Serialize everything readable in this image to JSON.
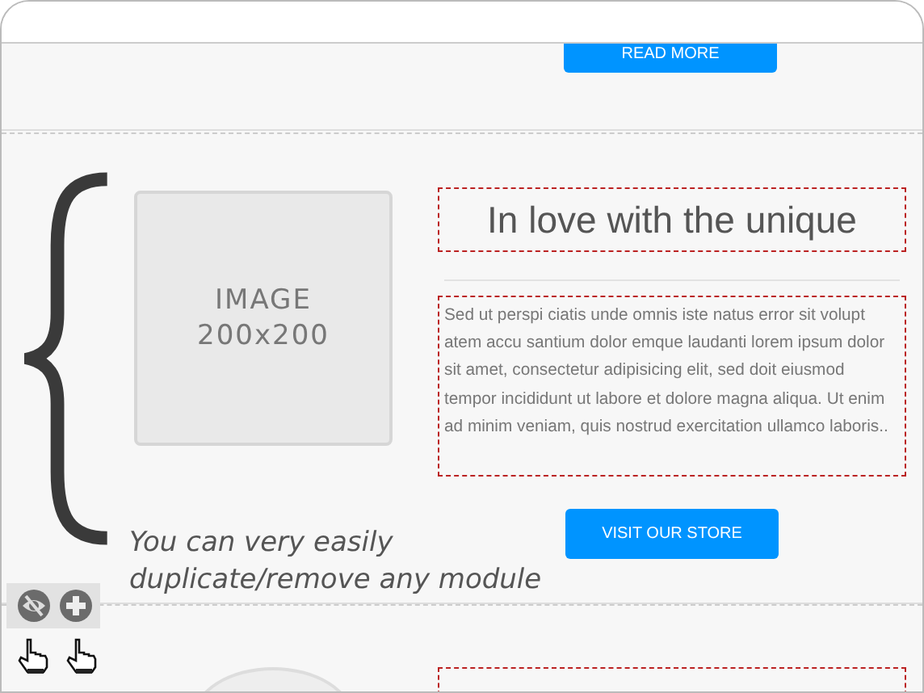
{
  "modules": [
    {
      "kind": "cta",
      "button": "READ MORE"
    },
    {
      "kind": "feature",
      "image_placeholder": [
        "IMAGE",
        "200x200"
      ],
      "title": "In love with the unique",
      "body": "Sed ut perspi ciatis unde omnis iste natus error sit volupt atem accu santium dolor emque laudanti lorem ipsum dolor sit amet, consectetur adipisicing elit, sed doit eiusmod tempor incididunt ut labore et dolore magna aliqua. Ut enim ad minim veniam, quis nostrud exercitation ullamco laboris..",
      "button": "VISIT OUR STORE"
    },
    {
      "kind": "partial"
    }
  ],
  "annotation": "You can very easily duplicate/remove any module"
}
